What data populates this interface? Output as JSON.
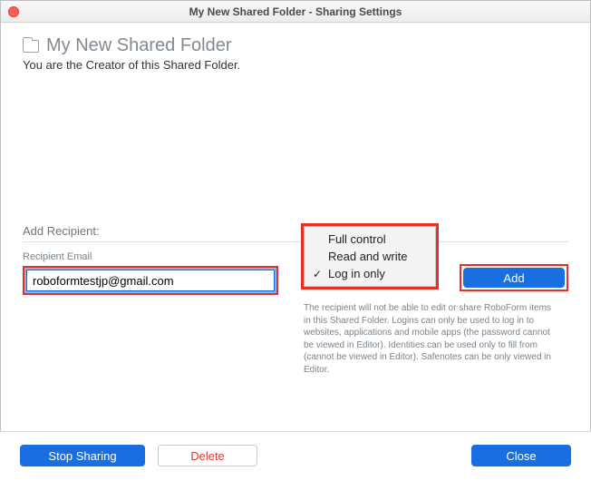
{
  "window": {
    "title": "My New Shared Folder - Sharing Settings"
  },
  "header": {
    "folder_name": "My New Shared Folder",
    "subtitle": "You are the Creator of this Shared Folder."
  },
  "recipient": {
    "section_label": "Add Recipient:",
    "email_label": "Recipient Email",
    "email_value": "roboformtestjp@gmail.com",
    "add_label": "Add",
    "permission_options": [
      {
        "label": "Full control",
        "selected": false
      },
      {
        "label": "Read and write",
        "selected": false
      },
      {
        "label": "Log in only",
        "selected": true
      }
    ],
    "permission_help": "The recipient will not be able to edit or share RoboForm items in this Shared Folder. Logins can only be used to log in to websites, applications and mobile apps (the password cannot be viewed in Editor). Identities can be used only to fill from (cannot be viewed in Editor). Safenotes can be only viewed in Editor."
  },
  "footer": {
    "stop_sharing": "Stop Sharing",
    "delete": "Delete",
    "close": "Close"
  },
  "colors": {
    "highlight_box": "#e5302a",
    "primary": "#1a6fe0"
  }
}
